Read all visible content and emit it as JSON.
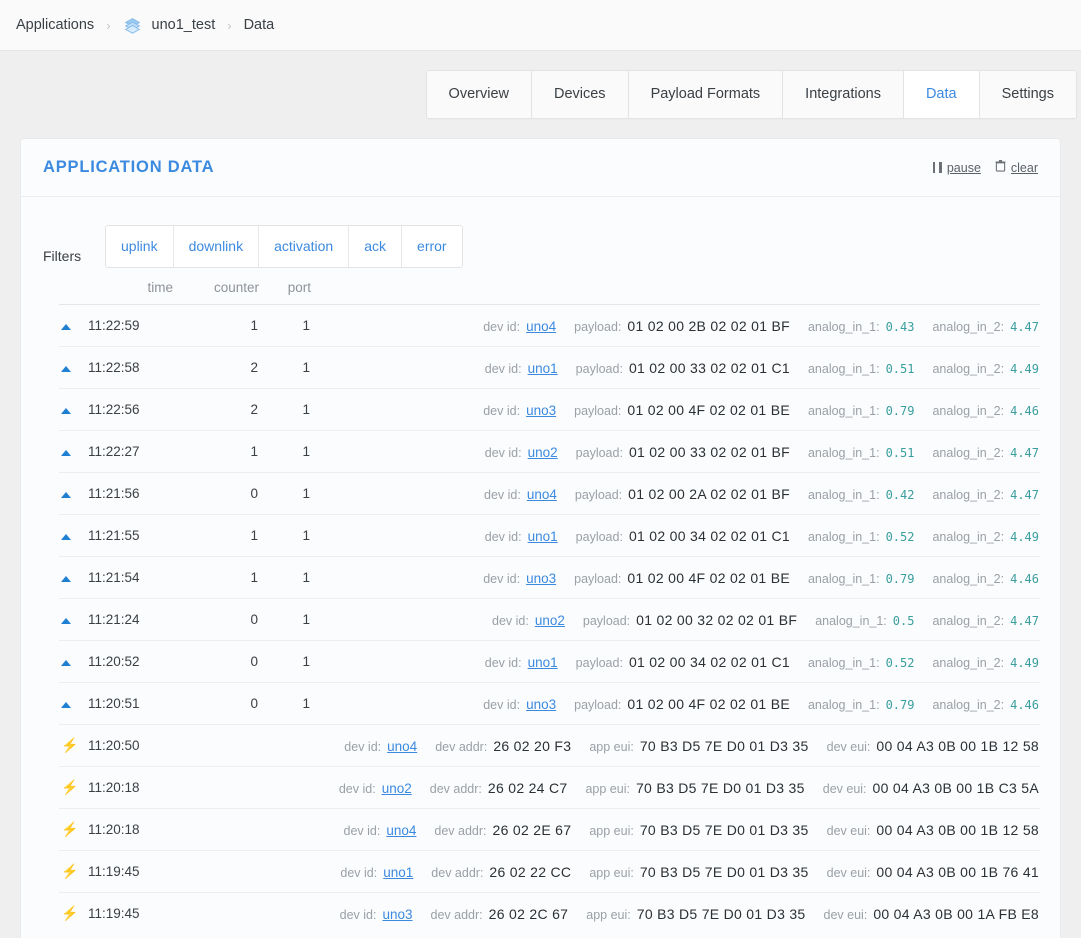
{
  "breadcrumb": {
    "root": "Applications",
    "separator": "›",
    "app_icon": "layers-icon",
    "app": "uno1_test",
    "section": "Data"
  },
  "tabs": [
    {
      "label": "Overview",
      "active": false
    },
    {
      "label": "Devices",
      "active": false
    },
    {
      "label": "Payload Formats",
      "active": false
    },
    {
      "label": "Integrations",
      "active": false
    },
    {
      "label": "Data",
      "active": true
    },
    {
      "label": "Settings",
      "active": false
    }
  ],
  "panel": {
    "title": "APPLICATION DATA",
    "pause_label": "pause",
    "pause_icon": "pause-icon",
    "clear_label": "clear",
    "clear_icon": "trash-icon"
  },
  "filters": {
    "label": "Filters",
    "options": [
      "uplink",
      "downlink",
      "activation",
      "ack",
      "error"
    ]
  },
  "table": {
    "headers": {
      "time": "time",
      "counter": "counter",
      "port": "port"
    },
    "keys": {
      "dev_id": "dev id:",
      "payload": "payload:",
      "analog_in_1": "analog_in_1:",
      "analog_in_2": "analog_in_2:",
      "dev_addr": "dev addr:",
      "app_eui": "app eui:",
      "dev_eui": "dev eui:"
    },
    "rows": [
      {
        "type": "uplink",
        "icon": "uplink-arrow-icon",
        "time": "11:22:59",
        "counter": "1",
        "port": "1",
        "dev_id": "uno4",
        "payload": "01 02 00 2B 02 02 01 BF",
        "analog_in_1": "0.43",
        "analog_in_2": "4.47"
      },
      {
        "type": "uplink",
        "icon": "uplink-arrow-icon",
        "time": "11:22:58",
        "counter": "2",
        "port": "1",
        "dev_id": "uno1",
        "payload": "01 02 00 33 02 02 01 C1",
        "analog_in_1": "0.51",
        "analog_in_2": "4.49"
      },
      {
        "type": "uplink",
        "icon": "uplink-arrow-icon",
        "time": "11:22:56",
        "counter": "2",
        "port": "1",
        "dev_id": "uno3",
        "payload": "01 02 00 4F 02 02 01 BE",
        "analog_in_1": "0.79",
        "analog_in_2": "4.46"
      },
      {
        "type": "uplink",
        "icon": "uplink-arrow-icon",
        "time": "11:22:27",
        "counter": "1",
        "port": "1",
        "dev_id": "uno2",
        "payload": "01 02 00 33 02 02 01 BF",
        "analog_in_1": "0.51",
        "analog_in_2": "4.47"
      },
      {
        "type": "uplink",
        "icon": "uplink-arrow-icon",
        "time": "11:21:56",
        "counter": "0",
        "port": "1",
        "dev_id": "uno4",
        "payload": "01 02 00 2A 02 02 01 BF",
        "analog_in_1": "0.42",
        "analog_in_2": "4.47"
      },
      {
        "type": "uplink",
        "icon": "uplink-arrow-icon",
        "time": "11:21:55",
        "counter": "1",
        "port": "1",
        "dev_id": "uno1",
        "payload": "01 02 00 34 02 02 01 C1",
        "analog_in_1": "0.52",
        "analog_in_2": "4.49"
      },
      {
        "type": "uplink",
        "icon": "uplink-arrow-icon",
        "time": "11:21:54",
        "counter": "1",
        "port": "1",
        "dev_id": "uno3",
        "payload": "01 02 00 4F 02 02 01 BE",
        "analog_in_1": "0.79",
        "analog_in_2": "4.46"
      },
      {
        "type": "uplink",
        "icon": "uplink-arrow-icon",
        "time": "11:21:24",
        "counter": "0",
        "port": "1",
        "dev_id": "uno2",
        "payload": "01 02 00 32 02 02 01 BF",
        "analog_in_1": "0.5",
        "analog_in_2": "4.47"
      },
      {
        "type": "uplink",
        "icon": "uplink-arrow-icon",
        "time": "11:20:52",
        "counter": "0",
        "port": "1",
        "dev_id": "uno1",
        "payload": "01 02 00 34 02 02 01 C1",
        "analog_in_1": "0.52",
        "analog_in_2": "4.49"
      },
      {
        "type": "uplink",
        "icon": "uplink-arrow-icon",
        "time": "11:20:51",
        "counter": "0",
        "port": "1",
        "dev_id": "uno3",
        "payload": "01 02 00 4F 02 02 01 BE",
        "analog_in_1": "0.79",
        "analog_in_2": "4.46"
      },
      {
        "type": "activation",
        "icon": "activation-bolt-icon",
        "time": "11:20:50",
        "counter": "",
        "port": "",
        "dev_id": "uno4",
        "dev_addr": "26 02 20 F3",
        "app_eui": "70 B3 D5 7E D0 01 D3 35",
        "dev_eui": "00 04 A3 0B 00 1B 12 58"
      },
      {
        "type": "activation",
        "icon": "activation-bolt-icon",
        "time": "11:20:18",
        "counter": "",
        "port": "",
        "dev_id": "uno2",
        "dev_addr": "26 02 24 C7",
        "app_eui": "70 B3 D5 7E D0 01 D3 35",
        "dev_eui": "00 04 A3 0B 00 1B C3 5A"
      },
      {
        "type": "activation",
        "icon": "activation-bolt-icon",
        "time": "11:20:18",
        "counter": "",
        "port": "",
        "dev_id": "uno4",
        "dev_addr": "26 02 2E 67",
        "app_eui": "70 B3 D5 7E D0 01 D3 35",
        "dev_eui": "00 04 A3 0B 00 1B 12 58"
      },
      {
        "type": "activation",
        "icon": "activation-bolt-icon",
        "time": "11:19:45",
        "counter": "",
        "port": "",
        "dev_id": "uno1",
        "dev_addr": "26 02 22 CC",
        "app_eui": "70 B3 D5 7E D0 01 D3 35",
        "dev_eui": "00 04 A3 0B 00 1B 76 41"
      },
      {
        "type": "activation",
        "icon": "activation-bolt-icon",
        "time": "11:19:45",
        "counter": "",
        "port": "",
        "dev_id": "uno3",
        "dev_addr": "26 02 2C 67",
        "app_eui": "70 B3 D5 7E D0 01 D3 35",
        "dev_eui": "00 04 A3 0B 00 1A FB E8"
      }
    ]
  },
  "colors": {
    "accent": "#3c8ae0",
    "uplink": "#1f7fd1",
    "activation": "#f5b942",
    "value": "#3a9e9e"
  }
}
